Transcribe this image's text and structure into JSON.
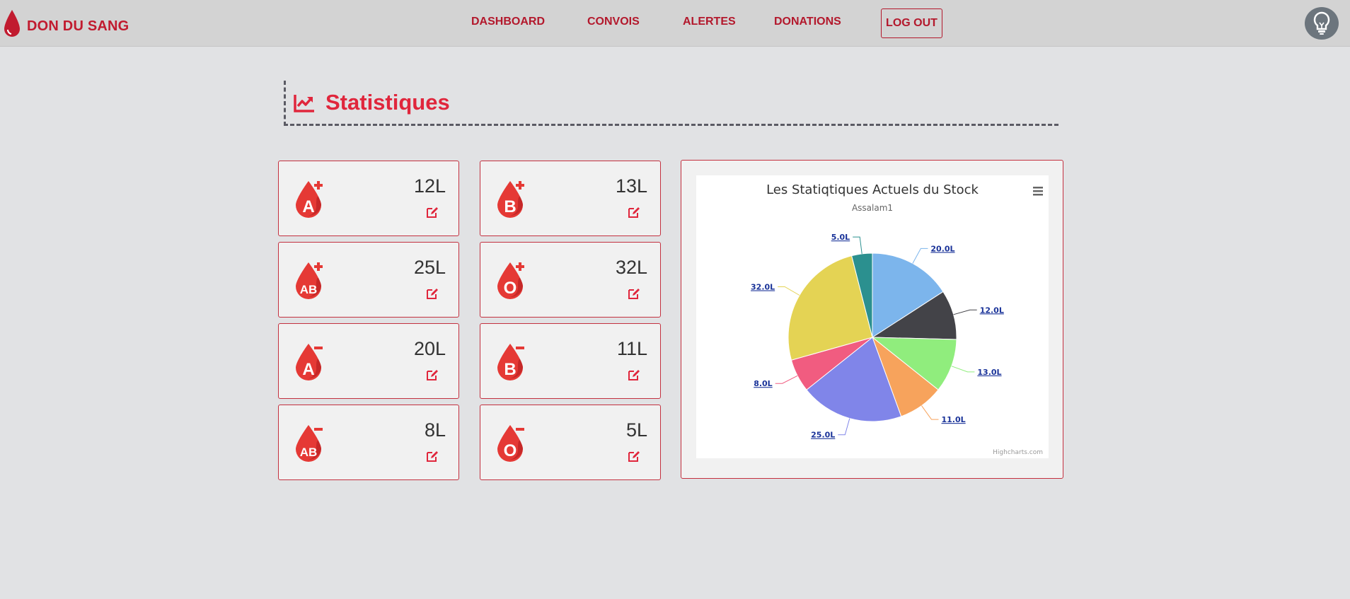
{
  "brand": {
    "name": "DON DU SANG",
    "color": "#c11b2f"
  },
  "nav": {
    "items": [
      {
        "label": "DASHBOARD"
      },
      {
        "label": "CONVOIS"
      },
      {
        "label": "ALERTES"
      },
      {
        "label": "DONATIONS"
      }
    ],
    "logout_label": "LOG OUT",
    "help_icon": "lightbulb-icon"
  },
  "page": {
    "title": "Statistiques",
    "title_icon": "line-chart-icon",
    "accent": "#e0263c"
  },
  "stocks": [
    {
      "group": "A",
      "sign": "+",
      "amount": "12L"
    },
    {
      "group": "B",
      "sign": "+",
      "amount": "13L"
    },
    {
      "group": "AB",
      "sign": "+",
      "amount": "25L"
    },
    {
      "group": "O",
      "sign": "+",
      "amount": "32L"
    },
    {
      "group": "A",
      "sign": "-",
      "amount": "20L"
    },
    {
      "group": "B",
      "sign": "-",
      "amount": "11L"
    },
    {
      "group": "AB",
      "sign": "-",
      "amount": "8L"
    },
    {
      "group": "O",
      "sign": "-",
      "amount": "5L"
    }
  ],
  "chart_data": {
    "type": "pie",
    "title": "Les Statiqtiques Actuels du Stock",
    "subtitle": "Assalam1",
    "credits": "Highcharts.com",
    "menu_icon": "hamburger-menu-icon",
    "slices": [
      {
        "label": "20.0L",
        "value": 20,
        "color": "#7cb5ec"
      },
      {
        "label": "12.0L",
        "value": 12,
        "color": "#434348"
      },
      {
        "label": "13.0L",
        "value": 13,
        "color": "#90ed7d"
      },
      {
        "label": "11.0L",
        "value": 11,
        "color": "#f7a35c"
      },
      {
        "label": "25.0L",
        "value": 25,
        "color": "#8085e9"
      },
      {
        "label": "8.0L",
        "value": 8,
        "color": "#f15c80"
      },
      {
        "label": "32.0L",
        "value": 32,
        "color": "#e4d354"
      },
      {
        "label": "5.0L",
        "value": 5,
        "color": "#2b908f"
      }
    ]
  }
}
